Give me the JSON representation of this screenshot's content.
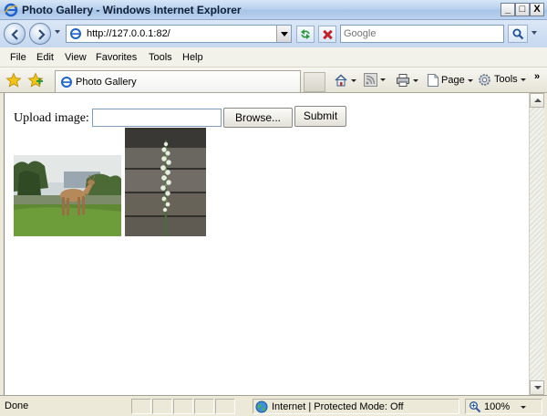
{
  "window": {
    "title": "Photo Gallery - Windows Internet Explorer",
    "minimize": "_",
    "maximize": "□",
    "close": "X"
  },
  "navigation": {
    "address": "http://127.0.0.1:82/",
    "search_placeholder": "Google"
  },
  "menu": {
    "items": [
      "File",
      "Edit",
      "View",
      "Favorites",
      "Tools",
      "Help"
    ]
  },
  "command_bar": {
    "tab_label": "Photo Gallery",
    "page_label": "Page",
    "tools_label": "Tools",
    "chevron": "»"
  },
  "page": {
    "upload_label": "Upload image:",
    "browse_label": "Browse...",
    "submit_label": "Submit",
    "photos": [
      {
        "subject": "deer on lawn"
      },
      {
        "subject": "flowering stalk against wooden fence"
      }
    ]
  },
  "status_bar": {
    "status": "Done",
    "zone": "Internet | Protected Mode: Off",
    "zoom": "100%"
  },
  "colors": {
    "titlebar": "#b9d1ee",
    "chrome": "#ece9d8",
    "content_bg": "#ffffff"
  }
}
